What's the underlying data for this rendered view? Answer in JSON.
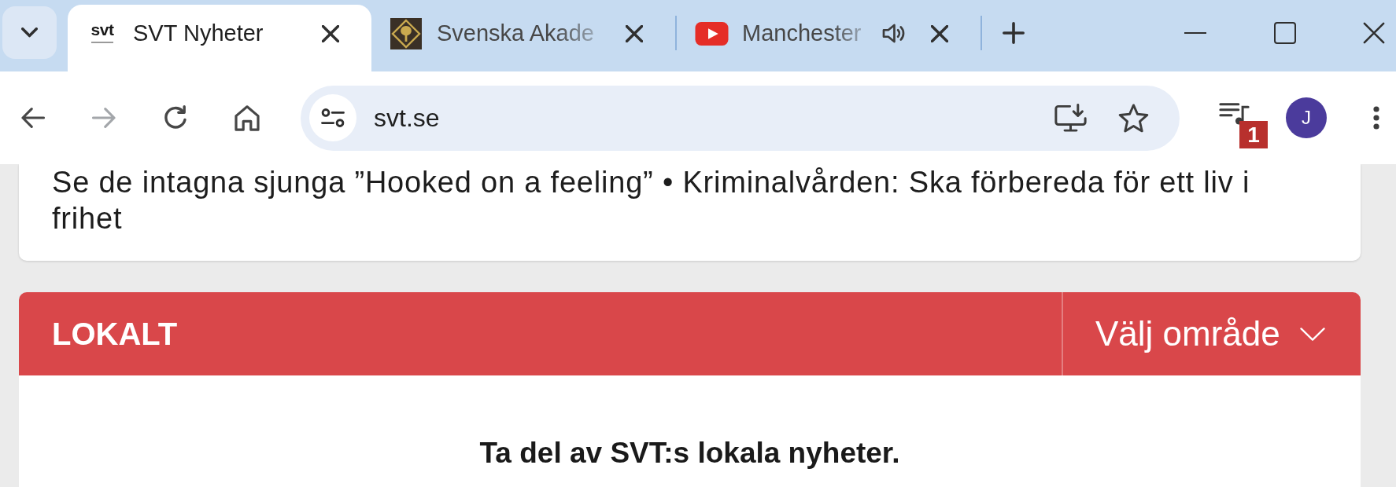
{
  "tab_strip": {
    "tabs": [
      {
        "title": "SVT Nyheter",
        "favicon": {
          "kind": "logo",
          "text": "svt"
        },
        "selected": true,
        "truncated": false,
        "audible": false
      },
      {
        "title": "Svenska Akade",
        "favicon": {
          "kind": "emblem"
        },
        "selected": false,
        "truncated": true,
        "audible": false
      },
      {
        "title": "Manchester",
        "favicon": {
          "kind": "video"
        },
        "selected": false,
        "truncated": true,
        "audible": true
      }
    ]
  },
  "toolbar": {
    "nav_buttons": [
      {
        "kind": "back",
        "disabled": false
      },
      {
        "kind": "forward",
        "disabled": true
      },
      {
        "kind": "reload",
        "disabled": false
      },
      {
        "kind": "home",
        "disabled": false
      }
    ],
    "address": {
      "value": "svt.se",
      "bookmarked": false
    },
    "avatar": {
      "initial": "J"
    },
    "annotation_marker": {
      "label": "1"
    }
  },
  "page": {
    "top_card": {
      "text": "Se de intagna sjunga ”Hooked on a feeling” • Kriminalvården: Ska förbereda för ett liv i frihet"
    },
    "local_section": {
      "title": "LOKALT",
      "region_selector": {
        "label": "Välj område"
      },
      "message": "Ta del av SVT:s lokala nyheter."
    }
  }
}
